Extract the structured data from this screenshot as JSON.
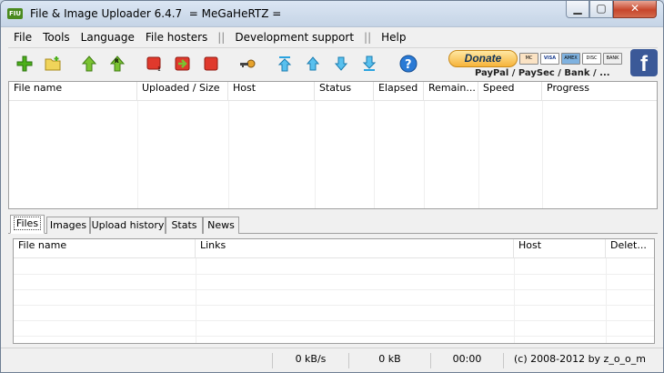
{
  "window": {
    "title": "File & Image Uploader 6.4.7  = MeGaHeRTZ =",
    "app_icon_label": "FIU",
    "min_glyph": "▁",
    "max_glyph": "▢",
    "close_glyph": "✕"
  },
  "menu": {
    "items": [
      "File",
      "Tools",
      "Language",
      "File hosters",
      "Development support",
      "Help"
    ],
    "separator": "||"
  },
  "toolbar": {
    "icons": [
      {
        "name": "add-file-icon",
        "color": "#4caf1a"
      },
      {
        "name": "add-folder-icon",
        "color": "#e6c53a"
      },
      {
        "name": "upload-icon",
        "color": "#5dad1f"
      },
      {
        "name": "upload-renamed-icon",
        "color": "#5dad1f"
      },
      {
        "name": "remove-icon",
        "color": "#d52b1e"
      },
      {
        "name": "move-icon",
        "color": "#d52b1e"
      },
      {
        "name": "stop-icon",
        "color": "#d52b1e"
      },
      {
        "name": "key-icon",
        "color": "#c88a20"
      },
      {
        "name": "move-top-icon",
        "color": "#2aa3e0"
      },
      {
        "name": "move-up-icon",
        "color": "#2aa3e0"
      },
      {
        "name": "move-down-icon",
        "color": "#2aa3e0"
      },
      {
        "name": "move-bottom-icon",
        "color": "#2aa3e0"
      },
      {
        "name": "help-icon",
        "color": "#2a7ad5"
      }
    ],
    "donate_label": "Donate",
    "donate_methods": "PayPal / PaySec / Bank / ...",
    "cards": [
      "MC",
      "VISA",
      "AMEX",
      "DISC",
      "BANK"
    ],
    "facebook_glyph": "f"
  },
  "upload_table": {
    "columns": [
      "File name",
      "Uploaded / Size",
      "Host",
      "Status",
      "Elapsed",
      "Remain...",
      "Speed",
      "Progress"
    ]
  },
  "tabs": {
    "items": [
      "Files",
      "Images",
      "Upload history",
      "Stats",
      "News"
    ],
    "active": "Files"
  },
  "files_table": {
    "columns": [
      "File name",
      "Links",
      "Host",
      "Delet..."
    ]
  },
  "status": {
    "speed": "0 kB/s",
    "size": "0 kB",
    "time": "00:00",
    "copyright": "(c) 2008-2012 by z_o_o_m"
  }
}
